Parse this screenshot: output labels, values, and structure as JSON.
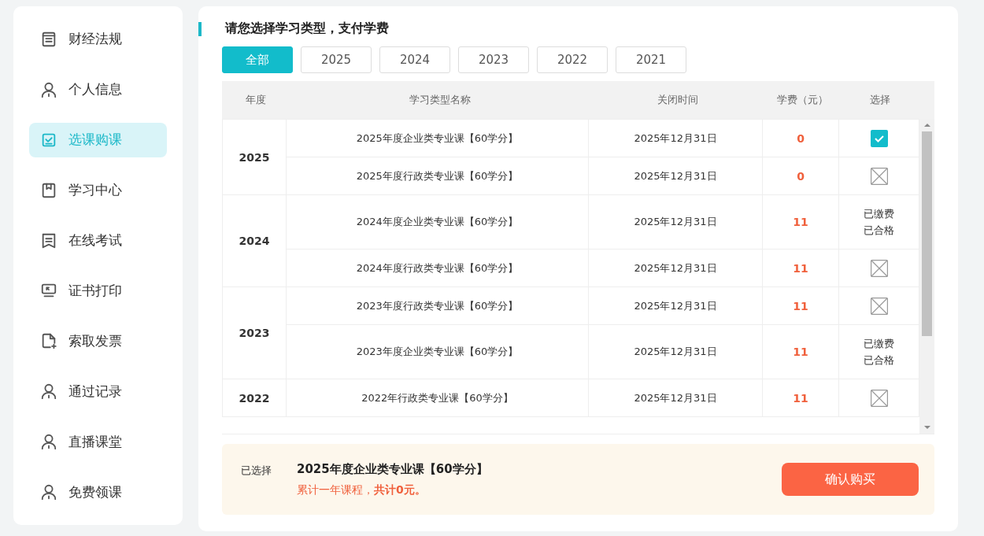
{
  "sidebar": {
    "items": [
      {
        "label": "财经法规",
        "selected": false
      },
      {
        "label": "个人信息",
        "selected": false
      },
      {
        "label": "选课购课",
        "selected": true
      },
      {
        "label": "学习中心",
        "selected": false
      },
      {
        "label": "在线考试",
        "selected": false
      },
      {
        "label": "证书打印",
        "selected": false
      },
      {
        "label": "索取发票",
        "selected": false
      },
      {
        "label": "通过记录",
        "selected": false
      },
      {
        "label": "直播课堂",
        "selected": false
      },
      {
        "label": "免费领课",
        "selected": false
      }
    ]
  },
  "heading": "请您选择学习类型，支付学费",
  "tabs": [
    {
      "label": "全部",
      "selected": true
    },
    {
      "label": "2025",
      "selected": false
    },
    {
      "label": "2024",
      "selected": false
    },
    {
      "label": "2023",
      "selected": false
    },
    {
      "label": "2022",
      "selected": false
    },
    {
      "label": "2021",
      "selected": false
    }
  ],
  "table": {
    "columns": [
      "年度",
      "学习类型名称",
      "关闭时间",
      "学费（元）",
      "选择"
    ],
    "groups": [
      {
        "year": "2025",
        "rows": [
          {
            "name": "2025年度企业类专业课【60学分】",
            "close": "2025年12月31日",
            "fee": "0",
            "select": {
              "kind": "checkbox",
              "checked": true
            }
          },
          {
            "name": "2025年度行政类专业课【60学分】",
            "close": "2025年12月31日",
            "fee": "0",
            "select": {
              "kind": "unavailable"
            }
          }
        ]
      },
      {
        "year": "2024",
        "rows": [
          {
            "name": "2024年度企业类专业课【60学分】",
            "close": "2025年12月31日",
            "fee": "11",
            "select": {
              "kind": "status",
              "lines": [
                "已缴费",
                "已合格"
              ]
            }
          },
          {
            "name": "2024年度行政类专业课【60学分】",
            "close": "2025年12月31日",
            "fee": "11",
            "select": {
              "kind": "unavailable"
            }
          }
        ]
      },
      {
        "year": "2023",
        "rows": [
          {
            "name": "2023年度行政类专业课【60学分】",
            "close": "2025年12月31日",
            "fee": "11",
            "select": {
              "kind": "unavailable"
            }
          },
          {
            "name": "2023年度企业类专业课【60学分】",
            "close": "2025年12月31日",
            "fee": "11",
            "select": {
              "kind": "status",
              "lines": [
                "已缴费",
                "已合格"
              ]
            }
          }
        ]
      },
      {
        "year": "2022",
        "rows": [
          {
            "name": "2022年行政类专业课【60学分】",
            "close": "2025年12月31日",
            "fee": "11",
            "select": {
              "kind": "unavailable"
            }
          }
        ]
      }
    ]
  },
  "summary": {
    "label": "已选择",
    "course": "2025年度企业类专业课【60学分】",
    "total": "累计一年课程，**共计0元。**",
    "button": "确认购买"
  }
}
